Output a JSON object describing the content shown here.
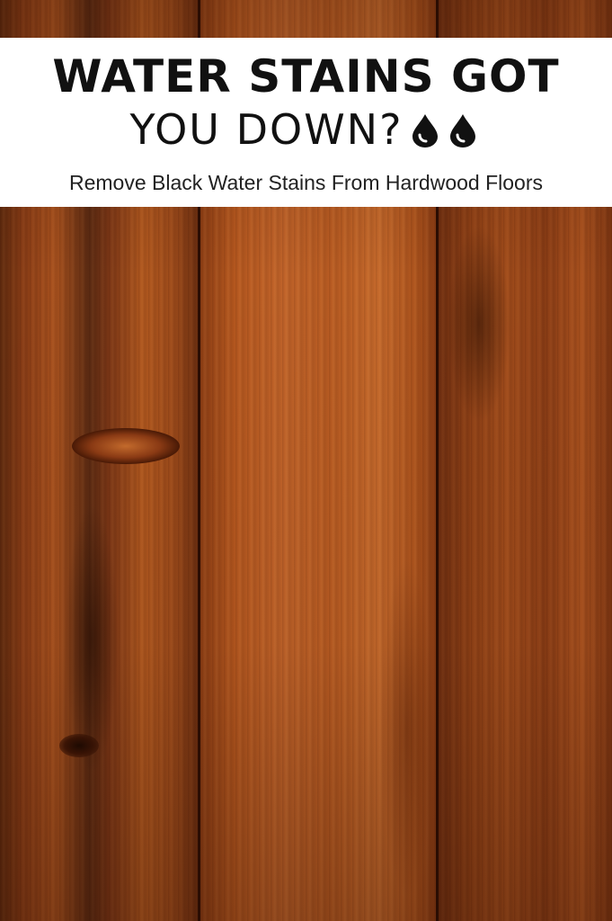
{
  "banner": {
    "title_line_1": "WATER STAINS GOT",
    "title_line_2": "YOU  DOWN?",
    "subtitle": "Remove Black Water Stains From Hardwood Floors",
    "drop_icons": [
      "water-drop-icon",
      "water-drop-icon"
    ]
  },
  "background": {
    "description_icon": "hardwood-planks",
    "colors": {
      "wood_dark": "#5e2a0e",
      "wood_mid": "#a9521e",
      "wood_light": "#c66a2c",
      "seam": "#2a0d03"
    }
  },
  "colors": {
    "banner_bg": "#ffffff",
    "title_text": "#111111",
    "subtitle_text": "#222222"
  }
}
